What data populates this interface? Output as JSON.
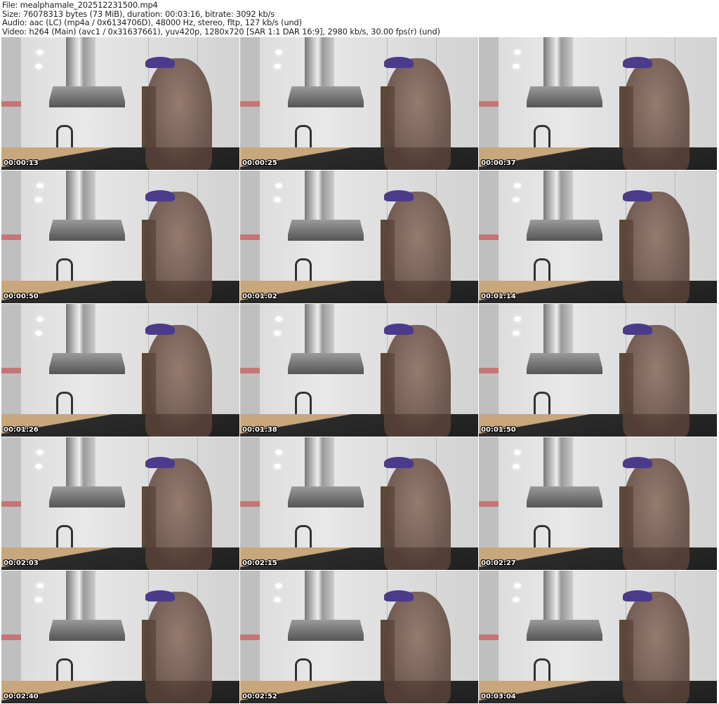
{
  "header": {
    "file": "File: mealphamale_202512231500.mp4",
    "size": "Size: 76078313 bytes (73 MiB), duration: 00:03:16, bitrate: 3092 kb/s",
    "audio": "Audio: aac (LC) (mp4a / 0x6134706D), 48000 Hz, stereo, fltp, 127 kb/s (und)",
    "video": "Video: h264 (Main) (avc1 / 0x31637661), yuv420p, 1280x720 [SAR 1:1 DAR 16:9], 2980 kb/s, 30.00 fps(r) (und)"
  },
  "thumbnails": [
    {
      "timestamp": "00:00:13"
    },
    {
      "timestamp": "00:00:25"
    },
    {
      "timestamp": "00:00:37"
    },
    {
      "timestamp": "00:00:50"
    },
    {
      "timestamp": "00:01:02"
    },
    {
      "timestamp": "00:01:14"
    },
    {
      "timestamp": "00:01:26"
    },
    {
      "timestamp": "00:01:38"
    },
    {
      "timestamp": "00:01:50"
    },
    {
      "timestamp": "00:02:03"
    },
    {
      "timestamp": "00:02:15"
    },
    {
      "timestamp": "00:02:27"
    },
    {
      "timestamp": "00:02:40"
    },
    {
      "timestamp": "00:02:52"
    },
    {
      "timestamp": "00:03:04"
    }
  ]
}
